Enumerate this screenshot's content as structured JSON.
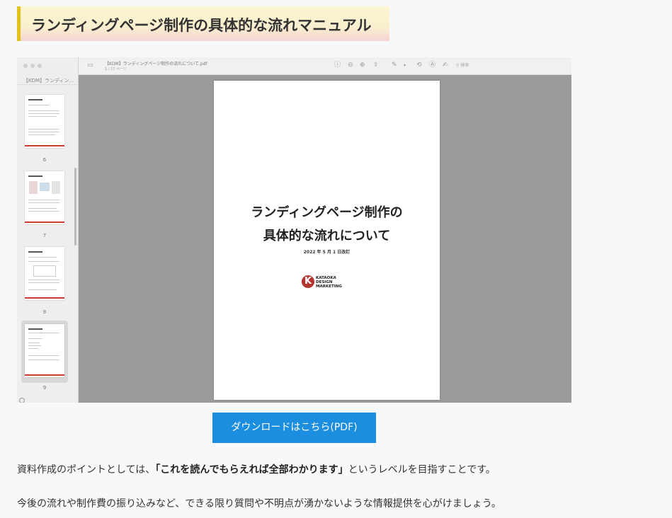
{
  "heading": "ランディングページ制作の具体的な流れマニュアル",
  "viewer": {
    "sidebar_title": "【KDM】ランディン…",
    "doc_title": "【KDM】ランディングページ制作の流れについて.pdf",
    "doc_subtitle": "1 / 17 ページ",
    "search_placeholder": "検索",
    "thumbnails": [
      "6",
      "7",
      "8",
      "9"
    ],
    "page": {
      "title_line1": "ランディングページ制作の",
      "title_line2": "具体的な流れについて",
      "date": "2022 年 5 月 1 日改訂",
      "logo_mark": "K",
      "logo_lines": [
        "KATAOKA",
        "DESIGN",
        "MARKETING"
      ]
    },
    "toolbar_icons": [
      "info-icon",
      "zoom-out-icon",
      "zoom-in-icon",
      "share-icon",
      "markup-icon",
      "chevron-down-icon",
      "rotate-icon",
      "annotate-icon",
      "sign-icon",
      "search-icon"
    ]
  },
  "download_button": "ダウンロードはこちら(PDF)",
  "paragraph1": {
    "before": "資料作成のポイントとしては、",
    "bold": "「これを読んでもらえれば全部わかります」",
    "after": "というレベルを目指すことです。"
  },
  "paragraph2": "今後の流れや制作費の振り込みなど、できる限り質問や不明点が湧かないような情報提供を心がけましょう。",
  "colors": {
    "heading_accent": "#e2c21a",
    "button": "#1c8ee0",
    "logo_red": "#b4342f"
  }
}
